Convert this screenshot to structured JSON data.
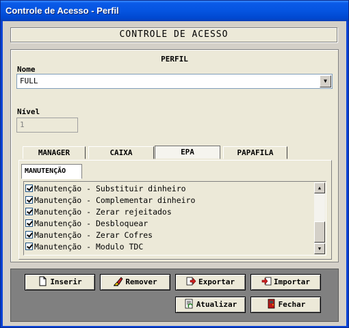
{
  "window": {
    "title": "Controle de Acesso - Perfil"
  },
  "header": {
    "title": "CONTROLE DE ACESSO"
  },
  "form": {
    "section_title": "PERFIL",
    "nome_label": "Nome",
    "nome_value": "FULL",
    "nivel_label": "Nível",
    "nivel_value": "1"
  },
  "tabs": [
    {
      "label": "MANAGER",
      "active": false
    },
    {
      "label": "CAIXA",
      "active": false
    },
    {
      "label": "EPA",
      "active": true
    },
    {
      "label": "PAPAFILA",
      "active": false
    }
  ],
  "subtab": {
    "label": "MANUTENÇÃO"
  },
  "permissions": [
    {
      "label": "Manutenção - Substituir dinheiro",
      "checked": true
    },
    {
      "label": "Manutenção - Complementar dinheiro",
      "checked": true
    },
    {
      "label": "Manutenção - Zerar rejeitados",
      "checked": true
    },
    {
      "label": "Manutenção - Desbloquear",
      "checked": true
    },
    {
      "label": "Manutenção - Zerar Cofres",
      "checked": true
    },
    {
      "label": "Manutenção - Modulo TDC",
      "checked": true
    }
  ],
  "buttons": {
    "inserir": "Inserir",
    "remover": "Remover",
    "exportar": "Exportar",
    "importar": "Importar",
    "atualizar": "Atualizar",
    "fechar": "Fechar"
  },
  "icons": {
    "inserir": "new-document-icon",
    "remover": "eraser-icon",
    "exportar": "export-arrow-icon",
    "importar": "import-arrow-icon",
    "atualizar": "refresh-document-icon",
    "fechar": "exit-door-icon"
  },
  "colors": {
    "titlebar": "#0554e0",
    "window_bg": "#ece9d8",
    "button_panel": "#808080"
  }
}
